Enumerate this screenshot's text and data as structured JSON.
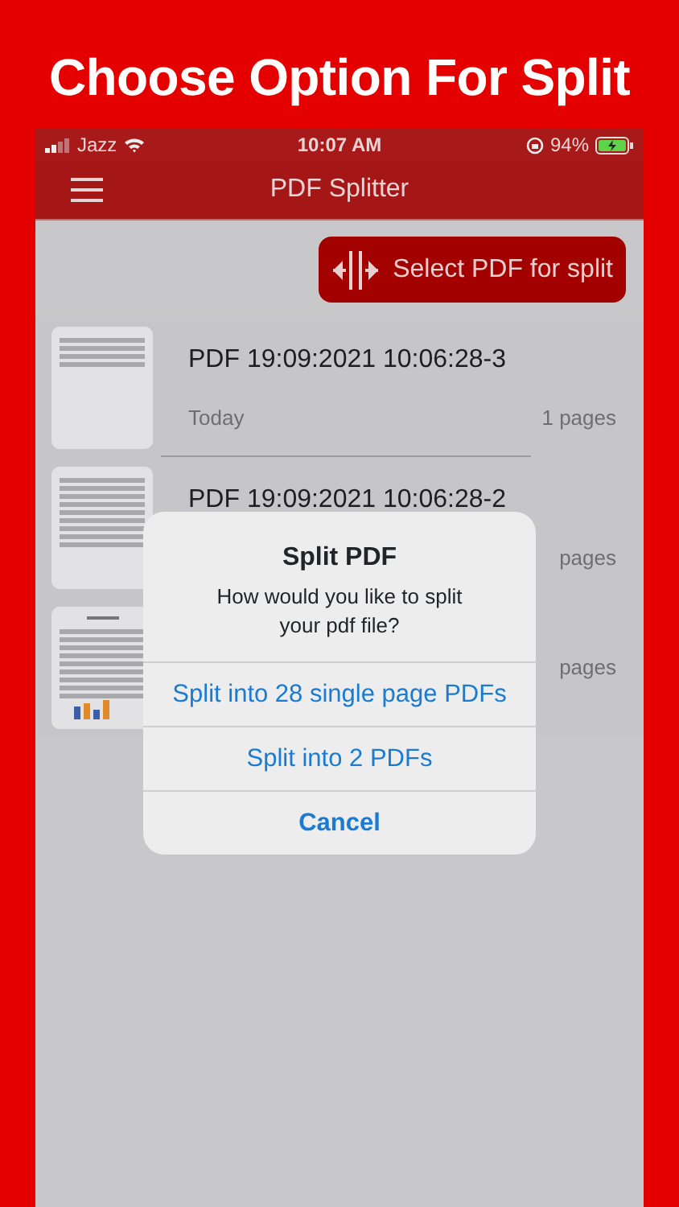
{
  "headline": "Choose Option For Split",
  "status_bar": {
    "carrier": "Jazz",
    "time": "10:07 AM",
    "battery": "94%"
  },
  "navbar": {
    "title": "PDF Splitter"
  },
  "select_button": {
    "label": "Select PDF for split"
  },
  "files": [
    {
      "kind": "picture",
      "title": "PDF 19:09:2021 10:06:28-3",
      "date": "Today",
      "pages": "1 pages"
    },
    {
      "kind": "picture",
      "title": "PDF 19:09:2021 10:06:28-2",
      "pages": "pages"
    },
    {
      "kind": "picture",
      "pages": "pages"
    }
  ],
  "dialog": {
    "title": "Split PDF",
    "message": "How would you like to split your pdf file?",
    "actions": [
      {
        "label": "Split into 28 single page PDFs",
        "kind": "default"
      },
      {
        "label": "Split into 2 PDFs",
        "kind": "default"
      },
      {
        "label": "Cancel",
        "kind": "cancel"
      }
    ]
  }
}
